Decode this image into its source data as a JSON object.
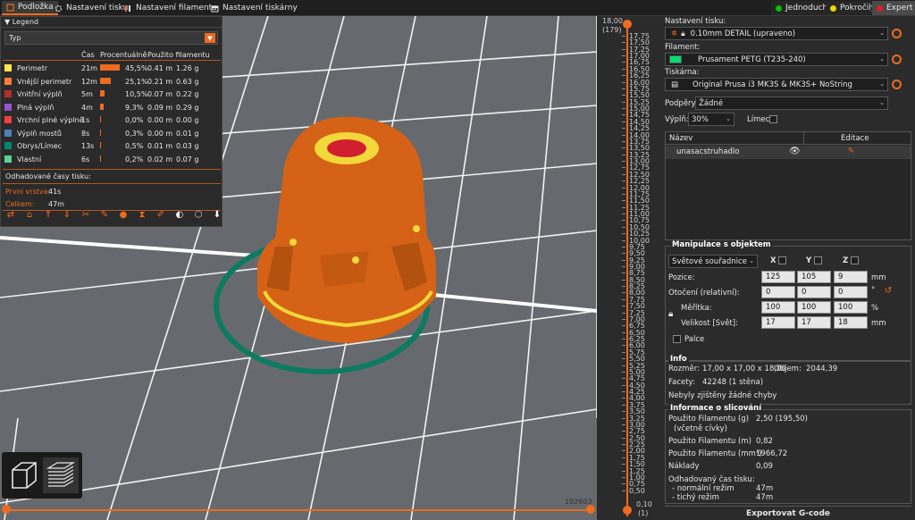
{
  "tabs": [
    {
      "label": "Podložka",
      "active": true,
      "icon": "cube-icon"
    },
    {
      "label": "Nastavení tisku",
      "active": false,
      "icon": "gear-icon"
    },
    {
      "label": "Nastavení filamentu",
      "active": false,
      "icon": "filament-icon"
    },
    {
      "label": "Nastavení tiskárny",
      "active": false,
      "icon": "printer-icon"
    }
  ],
  "modes": [
    {
      "label": "Jednoduchý",
      "color": "#00c000"
    },
    {
      "label": "Pokročilý",
      "color": "#e6d800"
    },
    {
      "label": "Expert",
      "color": "#e02020",
      "active": true
    }
  ],
  "legend": {
    "title": "Legend",
    "type_select": "Typ",
    "col_time": "Čas",
    "col_percent": "Procentuálně",
    "col_filament": "Použito filamentu",
    "rows": [
      {
        "name": "Perimetr",
        "color": "#ffe650",
        "time": "21m",
        "pct": "45,5%",
        "pct_value": 45.5,
        "len": "0.41 m",
        "weight": "1.26 g"
      },
      {
        "name": "Vnější perimetr",
        "color": "#ff7d38",
        "time": "12m",
        "pct": "25,1%",
        "pct_value": 25.1,
        "len": "0.21 m",
        "weight": "0.63 g"
      },
      {
        "name": "Vnitřní výplň",
        "color": "#b03029",
        "time": "5m",
        "pct": "10,5%",
        "pct_value": 10.5,
        "len": "0.07 m",
        "weight": "0.22 g"
      },
      {
        "name": "Plná výplň",
        "color": "#9654cc",
        "time": "4m",
        "pct": "9,3%",
        "pct_value": 9.3,
        "len": "0.09 m",
        "weight": "0.29 g"
      },
      {
        "name": "Vrchní plné výplně",
        "color": "#f04040",
        "time": "1s",
        "pct": "0,0%",
        "pct_value": 0.0,
        "len": "0.00 m",
        "weight": "0.00 g"
      },
      {
        "name": "Výplň mostů",
        "color": "#4d80ba",
        "time": "8s",
        "pct": "0,3%",
        "pct_value": 0.3,
        "len": "0.00 m",
        "weight": "0.01 g"
      },
      {
        "name": "Obrys/Límec",
        "color": "#00876e",
        "time": "13s",
        "pct": "0,5%",
        "pct_value": 0.5,
        "len": "0.01 m",
        "weight": "0.03 g"
      },
      {
        "name": "Vlastní",
        "color": "#5ed194",
        "time": "6s",
        "pct": "0,2%",
        "pct_value": 0.2,
        "len": "0.02 m",
        "weight": "0.07 g"
      }
    ],
    "est_title": "Odhadované časy tisku:",
    "first_layer_label": "První vrstva:",
    "first_layer_value": "41s",
    "total_label": "Celkem:",
    "total_value": "47m"
  },
  "viewport": {
    "move_count": "102603"
  },
  "ruler": {
    "top_value": "18,00",
    "top_layer": "(179)",
    "bottom_value": "0,10",
    "bottom_layer": "(1)",
    "ticks": [
      "17,75",
      "17,50",
      "17,25",
      "17,00",
      "16,75",
      "16,50",
      "16,25",
      "16,00",
      "15,75",
      "15,50",
      "15,25",
      "15,00",
      "14,75",
      "14,50",
      "14,25",
      "14,00",
      "13,75",
      "13,50",
      "13,25",
      "13,00",
      "12,75",
      "12,50",
      "12,25",
      "12,00",
      "11,75",
      "11,50",
      "11,25",
      "11,00",
      "10,75",
      "10,50",
      "10,25",
      "10,00",
      "9,75",
      "9,50",
      "9,25",
      "9,00",
      "8,75",
      "8,50",
      "8,25",
      "8,00",
      "7,75",
      "7,50",
      "7,25",
      "7,00",
      "6,75",
      "6,50",
      "6,25",
      "6,00",
      "5,75",
      "5,50",
      "5,25",
      "5,00",
      "4,75",
      "4,50",
      "4,25",
      "4,00",
      "3,75",
      "3,50",
      "3,25",
      "3,00",
      "2,75",
      "2,50",
      "2,25",
      "2,00",
      "1,75",
      "1,50",
      "1,25",
      "1,00",
      "0,75",
      "0,50"
    ]
  },
  "panel": {
    "print_label": "Nastavení tisku:",
    "print_value": "0.10mm DETAIL (upraveno)",
    "filament_label": "Filament:",
    "filament_value": "Prusament PETG (T235-240)",
    "filament_color": "#00e070",
    "printer_label": "Tiskárna:",
    "printer_value": "Original Prusa i3 MK3S & MK3S+ NoString",
    "supports_label": "Podpěry:",
    "supports_value": "Žádné",
    "infill_label": "Výplň:",
    "infill_value": "30%",
    "brim_label": "Límec:",
    "list_col_name": "Název",
    "list_col_edit": "Editace",
    "object_name": "unasacstruhadlo",
    "manip_title": "Manipulace s objektem",
    "coord_system": "Světové souřadnice",
    "axis_x": "X",
    "axis_y": "Y",
    "axis_z": "Z",
    "pos_label": "Pozice:",
    "pos": [
      "125",
      "105",
      "9"
    ],
    "pos_unit": "mm",
    "rot_label": "Otočení (relativní):",
    "rot": [
      "0",
      "0",
      "0"
    ],
    "rot_unit": "°",
    "scale_label": "Měřítka:",
    "scale": [
      "100",
      "100",
      "100"
    ],
    "scale_unit": "%",
    "size_label": "Velikost [Svět]:",
    "size": [
      "17",
      "17",
      "18"
    ],
    "size_unit": "mm",
    "inches_label": "Palce",
    "info_title": "Info",
    "size_info_label": "Rozměr:",
    "size_info_value": "17,00 x 17,00 x 18,00",
    "volume_label": "Objem:",
    "volume_value": "2044,39",
    "facets_label": "Facety:",
    "facets_value": "42248 (1 stěna)",
    "errors_text": "Nebyly zjištěny žádné chyby",
    "slice_title": "Informace o slicování",
    "used_g_label": "Použito Filamentu (g)",
    "used_g_sub": "(včetně cívky)",
    "used_g_value": "2,50 (195,50)",
    "used_m_label": "Použito Filamentu (m)",
    "used_m_value": "0,82",
    "used_mm3_label": "Použito Filamentu (mm³)",
    "used_mm3_value": "1966,72",
    "cost_label": "Náklady",
    "cost_value": "0,09",
    "est_label": "Odhadovaný čas tisku:",
    "normal_label": "- normální režim",
    "normal_value": "47m",
    "silent_label": "- tichý režim",
    "silent_value": "47m",
    "export_label": "Exportovat G-code"
  }
}
